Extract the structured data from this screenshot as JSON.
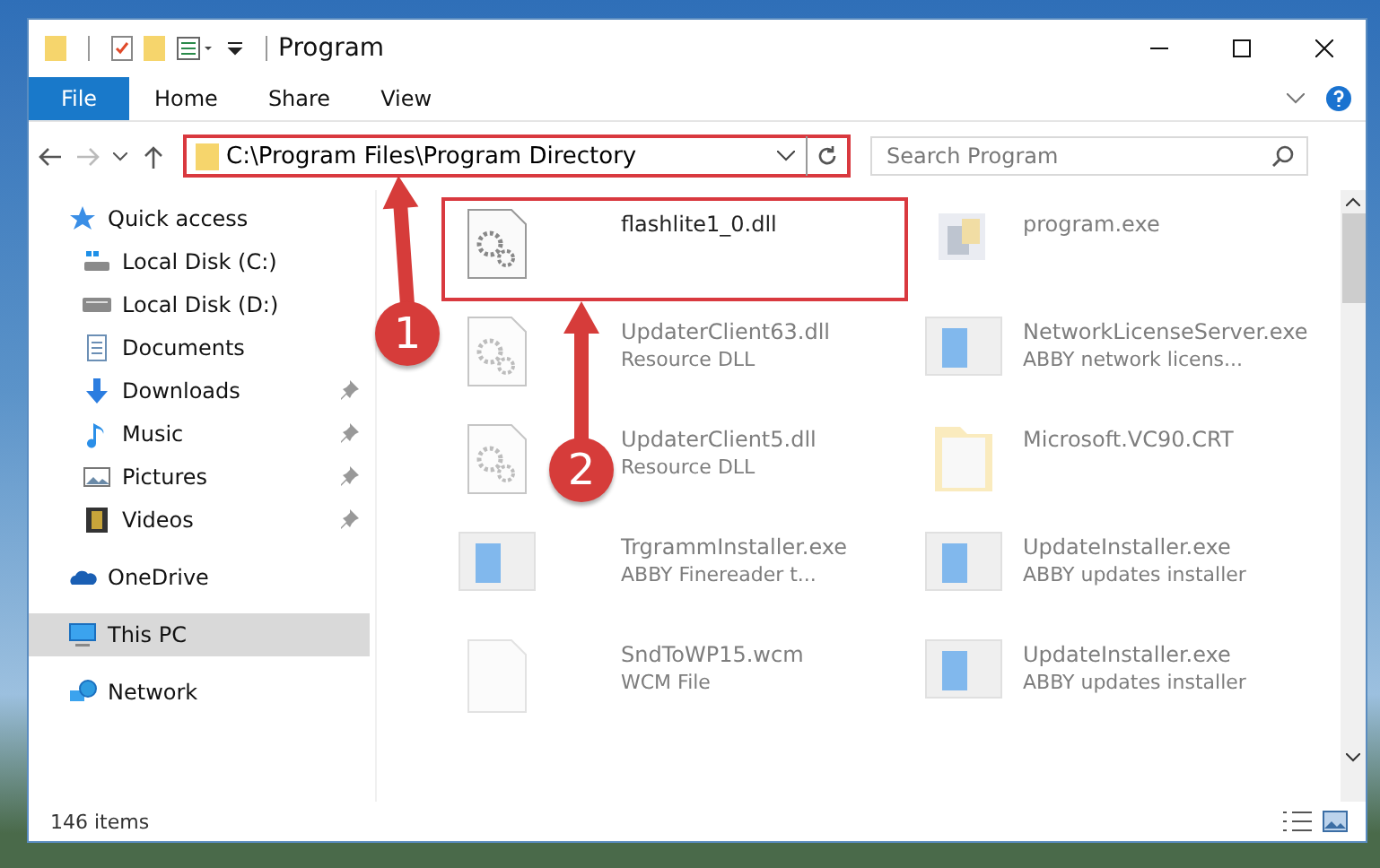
{
  "window": {
    "title": "Program"
  },
  "ribbon_tabs": [
    {
      "label": "File",
      "kind": "file"
    },
    {
      "label": "Home",
      "kind": "tab"
    },
    {
      "label": "Share",
      "kind": "tab"
    },
    {
      "label": "View",
      "kind": "tab"
    }
  ],
  "address": {
    "path": "C:\\Program Files\\Program Directory",
    "highlighted": true
  },
  "search": {
    "placeholder": "Search Program"
  },
  "sidebar": {
    "items": [
      {
        "label": "Quick access",
        "kind": "star",
        "selected": false,
        "children": [
          {
            "label": "Local Disk (C:)",
            "kind": "drive-win",
            "pinned": false,
            "selected": false
          },
          {
            "label": "Local Disk (D:)",
            "kind": "drive",
            "pinned": false,
            "selected": false
          },
          {
            "label": "Documents",
            "kind": "documents",
            "pinned": false,
            "selected": false
          },
          {
            "label": "Downloads",
            "kind": "downloads",
            "pinned": true,
            "selected": false
          },
          {
            "label": "Music",
            "kind": "music",
            "pinned": true,
            "selected": false
          },
          {
            "label": "Pictures",
            "kind": "pictures",
            "pinned": true,
            "selected": false
          },
          {
            "label": "Videos",
            "kind": "videos",
            "pinned": true,
            "selected": false
          }
        ]
      },
      {
        "label": "OneDrive",
        "kind": "cloud",
        "selected": false
      },
      {
        "label": "This PC",
        "kind": "pc",
        "selected": true
      },
      {
        "label": "Network",
        "kind": "network",
        "selected": false
      }
    ]
  },
  "files": [
    {
      "name": "flashlite1_0.dll",
      "kind": "dll",
      "faded": false,
      "highlighted": true
    },
    {
      "name": "program.exe",
      "kind": "app",
      "faded": true,
      "highlighted": false
    },
    {
      "name": "UpdaterClient63.dll",
      "description": "Resource DLL",
      "kind": "dll",
      "faded": true,
      "highlighted": false
    },
    {
      "name": "NetworkLicenseServer.exe",
      "description": "ABBY network licens...",
      "kind": "installer",
      "faded": true,
      "highlighted": false
    },
    {
      "name": "UpdaterClient5.dll",
      "description": "Resource DLL",
      "kind": "dll",
      "faded": true,
      "highlighted": false
    },
    {
      "name": "Microsoft.VC90.CRT",
      "kind": "folder",
      "faded": true,
      "highlighted": false
    },
    {
      "name": "TrgrammInstaller.exe",
      "description": "ABBY Finereader t...",
      "kind": "installer",
      "faded": true,
      "highlighted": false
    },
    {
      "name": "UpdateInstaller.exe",
      "description": "ABBY updates installer",
      "kind": "installer",
      "faded": true,
      "highlighted": false
    },
    {
      "name": "SndToWP15.wcm",
      "description": "WCM File",
      "kind": "blank",
      "faded": true,
      "highlighted": false
    },
    {
      "name": "UpdateInstaller.exe",
      "description": "ABBY updates installer",
      "kind": "installer",
      "faded": true,
      "highlighted": false
    }
  ],
  "status_bar": {
    "text": "146 items"
  },
  "annotations": [
    {
      "label": "1"
    },
    {
      "label": "2"
    }
  ]
}
